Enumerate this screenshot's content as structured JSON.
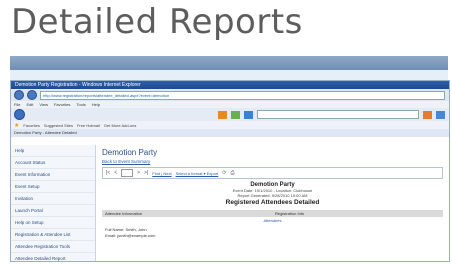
{
  "slide": {
    "title": "Detailed Reports"
  },
  "browser": {
    "window_title": "Demotion Party Registration - Windows Internet Explorer",
    "address": "http://www.registration/reports/attendee_detailed.aspx?event=demotion",
    "menu": [
      "File",
      "Edit",
      "View",
      "Favorites",
      "Tools",
      "Help"
    ],
    "favorites_label": "Favorites",
    "favorites_items": [
      "Suggested Sites",
      "Free Hotmail",
      "Get More Add-ons"
    ],
    "tab_label": "Demotion Party - Attendee Detailed"
  },
  "sidebar": {
    "items": [
      "Help",
      "Account Status",
      "Event Information",
      "Event Setup",
      "Invitation",
      "Launch Portal",
      "Help on Setup",
      "Registration & Attendee List",
      "Attendee Registration Tools",
      "Attendee Detailed Report"
    ]
  },
  "main": {
    "event_title": "Demotion Party",
    "back_link": "Back to Event Summary",
    "page_of": "1",
    "find_next": "Find | Next",
    "export_label": "Select a format ▾ Export"
  },
  "report": {
    "title": "Demotion Party",
    "line1": "Event Date: 10/1/2010 - Location: Clubhouse",
    "line2": "Report Generated: 9/28/2010 10:00 AM",
    "heading": "Registered Attendees Detailed",
    "col1": "Attendee Information",
    "col2": "Registration Info",
    "sub": "Attendees",
    "row1": "Full Name: Smith, John",
    "row2": "Email: jsmith@example.com"
  },
  "colors": {
    "title": "#5d5d5d",
    "accent": "#6f8fb3",
    "ie_title": "#1b4a92"
  }
}
